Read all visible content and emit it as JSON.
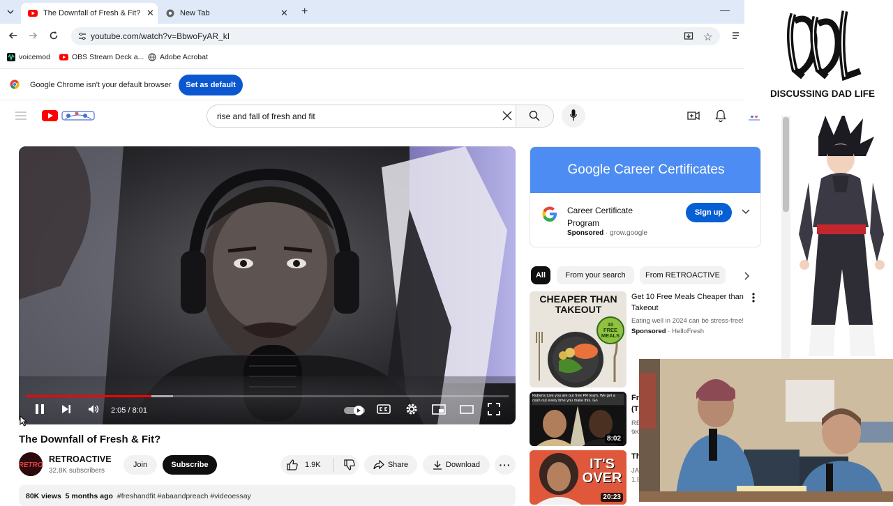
{
  "browser": {
    "tabs": [
      {
        "title": "The Downfall of Fresh & Fit? - Y",
        "active": true
      },
      {
        "title": "New Tab",
        "active": false
      }
    ],
    "url": "youtube.com/watch?v=BbwoFyAR_kI",
    "bookmarks": [
      "voicemod",
      "OBS Stream Deck a...",
      "Adobe Acrobat"
    ],
    "infobar": {
      "message": "Google Chrome isn't your default browser",
      "button": "Set as default"
    }
  },
  "youtube": {
    "search": {
      "query": "rise and fall of fresh and fit"
    },
    "player": {
      "time": "2:05 / 8:01",
      "played_fraction": 0.26,
      "buffered_fraction": 0.305
    },
    "video": {
      "title": "The Downfall of Fresh & Fit?",
      "channel": "RETROACTIVE",
      "subscribers": "32.8K subscribers",
      "join_label": "Join",
      "subscribe_label": "Subscribe",
      "likes": "1.9K",
      "share_label": "Share",
      "download_label": "Download",
      "views": "80K views",
      "age": "5 months ago",
      "hashtags": "#freshandfit #abaandpreach #videoessay"
    },
    "ad": {
      "banner": "Google Career Certificates",
      "title": "Career Certificate Program",
      "sponsored": "Sponsored",
      "domain": "grow.google",
      "cta": "Sign up"
    },
    "chips": [
      "All",
      "From your search",
      "From RETROACTIVE"
    ],
    "recommendations": [
      {
        "thumb_headline": "CHEAPER THAN TAKEOUT",
        "thumb_badge": "10 FREE MEALS",
        "title": "Get 10 Free Meals Cheaper than Takeout",
        "description": "Eating well in 2024 can be stress-free!",
        "sponsored": "Sponsored",
        "advertiser": "HelloFresh"
      },
      {
        "thumb_caption": "Rubens Live you are our free PR team. We get a cash out every time you make this. Go",
        "duration": "8:02",
        "title_fragment": "Fr",
        "title_fragment2": "(T",
        "meta_fragment": "RE",
        "meta_fragment2": "9K"
      },
      {
        "thumb_headline": "IT'S OVER",
        "duration": "20:23",
        "title_fragment": "Th",
        "meta_fragment": "JA",
        "meta_fragment2": "1.5"
      }
    ]
  },
  "overlay": {
    "logo_text": "DISCUSSING DAD LIFE"
  },
  "colors": {
    "tab_strip": "#dfe9f7",
    "chrome_blue": "#0b57d0",
    "yt_red": "#ff0000",
    "ad_blue": "#4d8df3",
    "signup_blue": "#065fd4"
  }
}
